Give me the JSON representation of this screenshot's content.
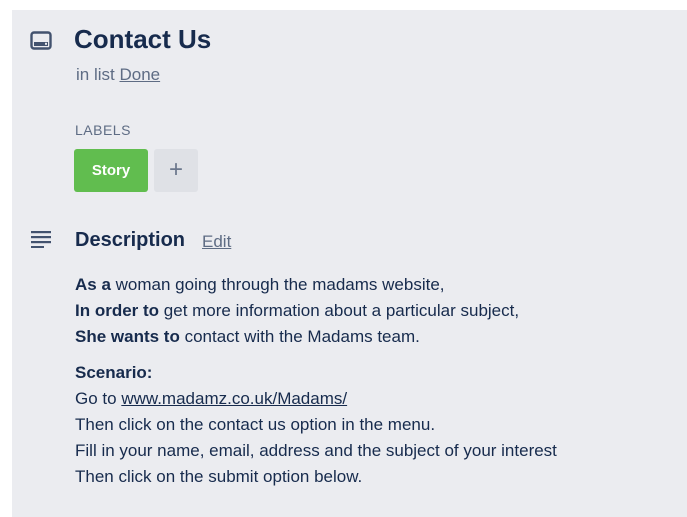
{
  "card": {
    "title": "Contact Us",
    "in_list_prefix": "in list",
    "list_name": "Done",
    "icon": "card-icon"
  },
  "labels": {
    "heading": "LABELS",
    "items": [
      {
        "text": "Story",
        "color": "#61bd4f"
      }
    ],
    "add_symbol": "+"
  },
  "description": {
    "icon": "description-lines-icon",
    "heading": "Description",
    "edit_label": "Edit",
    "story": [
      {
        "bold": "As a",
        "text": " woman going through the madams website,"
      },
      {
        "bold": "In order to",
        "text": " get more information about a particular subject,"
      },
      {
        "bold": "She wants to",
        "text": " contact with the Madams team."
      }
    ],
    "scenario_heading": "Scenario:",
    "scenario_goto_prefix": "Go to ",
    "scenario_link": "www.madamz.co.uk/Madams/",
    "scenario_steps": [
      "Then click on the contact us option in the menu.",
      "Fill in your name, email, address and the subject of your interest",
      "Then click on the submit option below."
    ]
  },
  "colors": {
    "panel_bg": "#ebecf0",
    "text_primary": "#172b4d",
    "text_secondary": "#5e6c84",
    "label_green": "#61bd4f",
    "add_button_bg": "#dfe1e6"
  }
}
